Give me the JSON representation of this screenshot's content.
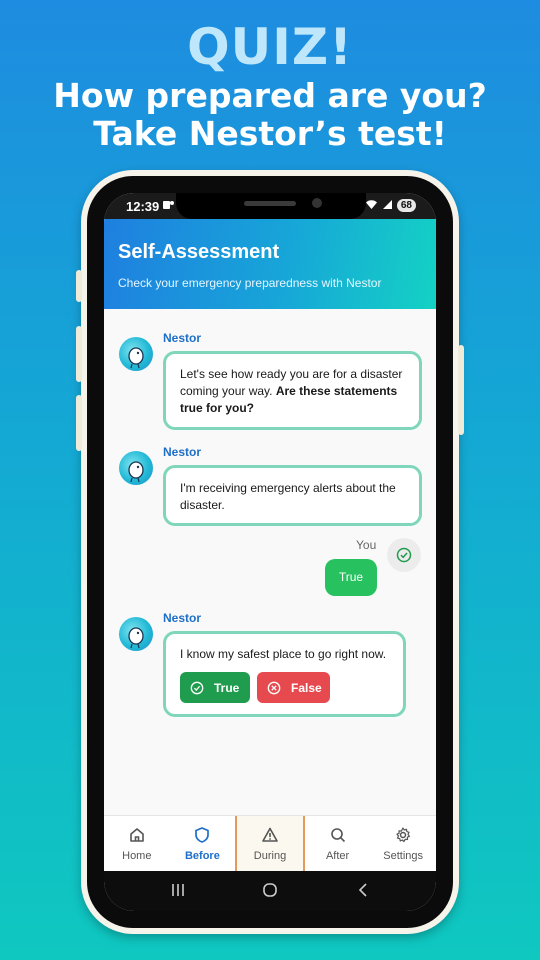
{
  "promo": {
    "quiz": "QUIZ!",
    "line1": "How prepared are you?",
    "line2": "Take Nestor’s test!"
  },
  "status": {
    "time": "12:39",
    "battery": "68"
  },
  "header": {
    "title": "Self-Assessment",
    "subtitle": "Check your emergency preparedness with Nestor"
  },
  "chat": {
    "bot_name": "Nestor",
    "msg1_plain": "Let's see how ready you are for a disaster coming your way. ",
    "msg1_bold": "Are these statements true for you?",
    "msg2": "I'm receiving emergency alerts about the disaster.",
    "you_label": "You",
    "user_reply": "True",
    "msg3": "I know my safest place to go right now.",
    "true_label": "True",
    "false_label": "False"
  },
  "tabs": {
    "home": "Home",
    "before": "Before",
    "during": "During",
    "after": "After",
    "settings": "Settings"
  },
  "colors": {
    "accent": "#1f6fc8",
    "bubble_border": "#7fd6ba",
    "true_button": "#1f9c4d",
    "false_button": "#e64a4f",
    "user_bubble": "#27c25f"
  }
}
